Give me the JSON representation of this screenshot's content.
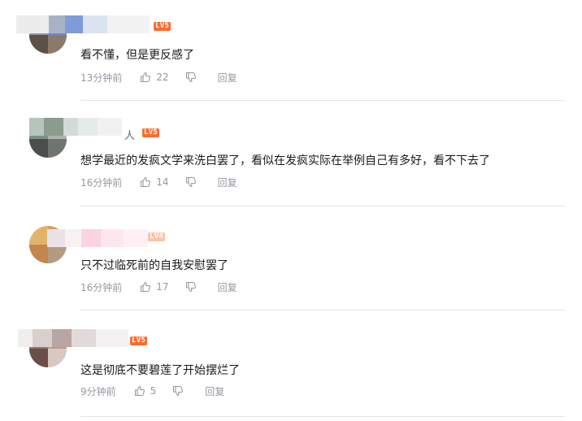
{
  "comments": [
    {
      "level": "LV5",
      "text": "看不懂，但是更反感了",
      "time": "13分钟前",
      "likes": "22",
      "reply": "回复"
    },
    {
      "level": "LV5",
      "name_tail": "人",
      "text": "想学最近的发疯文学来洗白罢了，看似在发疯实际在举例自己有多好，看不下去了",
      "time": "16分钟前",
      "likes": "14",
      "reply": "回复"
    },
    {
      "level": "LV4",
      "text": "只不过临死前的自我安慰罢了",
      "time": "16分钟前",
      "likes": "17",
      "reply": "回复"
    },
    {
      "level": "LV5",
      "text": "这是彻底不要碧莲了开始摆烂了",
      "time": "9分钟前",
      "likes": "5",
      "reply": "回复"
    }
  ],
  "colors": {
    "level5": "#ff6a2c",
    "level4": "#ffc2a7",
    "meta_text": "#9499a0",
    "divider": "#e3e5e7"
  },
  "icons": {
    "like": "thumbs-up-icon",
    "dislike": "thumbs-down-icon"
  }
}
